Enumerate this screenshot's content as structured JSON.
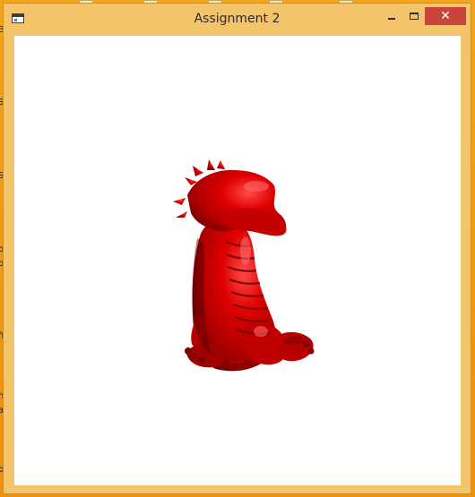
{
  "window": {
    "title": "Assignment 2",
    "minimize_icon": "minimize-icon",
    "maximize_icon": "maximize-icon",
    "close_icon": "close-icon",
    "close_glyph": "✕"
  },
  "desktop": {
    "fragments": [
      "Bi",
      "S",
      "S",
      "o",
      "o",
      "l",
      "ff",
      "n",
      "a",
      "pi"
    ]
  },
  "colors": {
    "desktop_background": "#f09a12",
    "window_frame": "#f3c46a",
    "close_button": "#c7453b",
    "client_background": "#ffffff",
    "model_color": "#d10000"
  },
  "viewport": {
    "content": "red-dragon-3d-render"
  }
}
